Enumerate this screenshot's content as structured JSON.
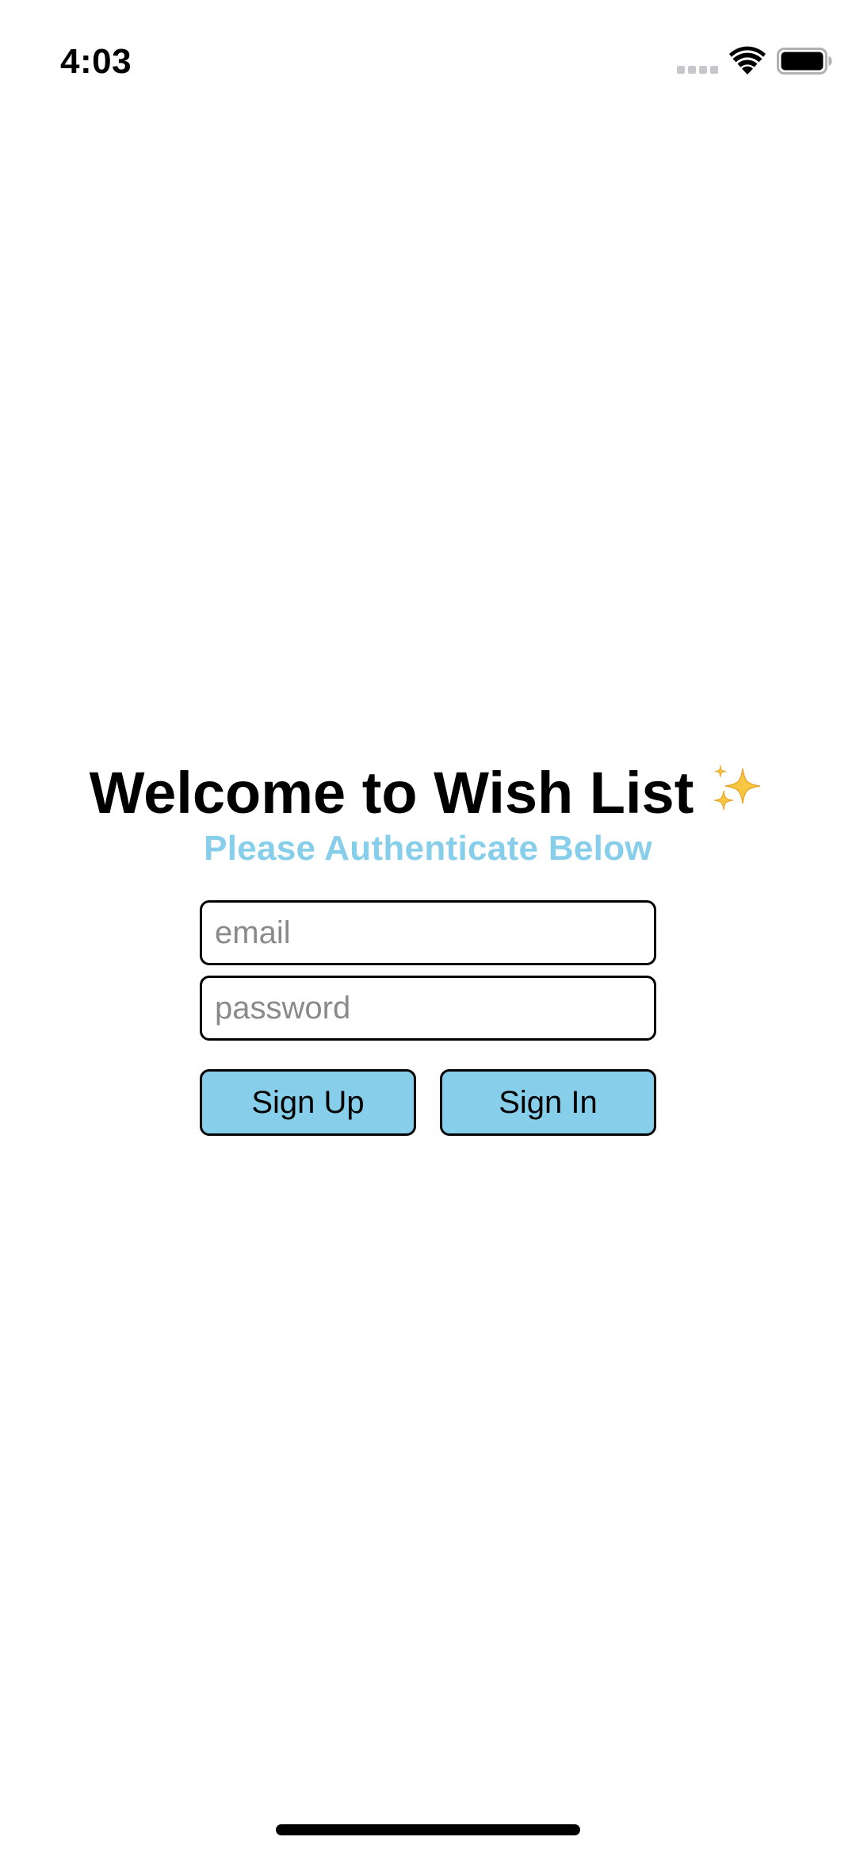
{
  "status_bar": {
    "time": "4:03"
  },
  "auth": {
    "title": "Welcome to Wish List",
    "subtitle": "Please Authenticate Below",
    "email_placeholder": "email",
    "password_placeholder": "password",
    "sign_up_label": "Sign Up",
    "sign_in_label": "Sign In"
  },
  "icons": {
    "title_emoji": "sparkles-icon",
    "signal": "cellular-signal-icon",
    "wifi": "wifi-icon",
    "battery": "battery-icon"
  },
  "colors": {
    "accent": "#87CEEB",
    "button_border": "#000000",
    "placeholder": "#8A8A8D"
  }
}
